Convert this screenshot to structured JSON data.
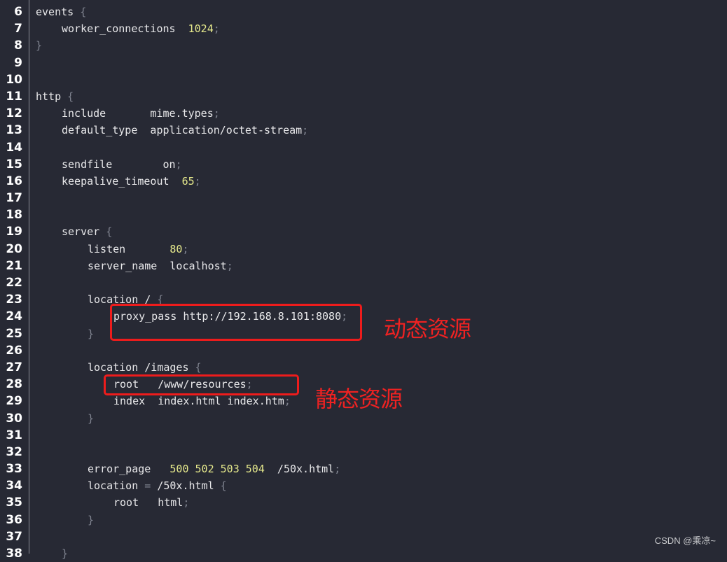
{
  "colors": {
    "background": "#272934",
    "line_number": "#ffffff",
    "code_text": "#e8e8ea",
    "number": "#e6e98c",
    "punctuation": "#7f838f",
    "annotation": "#ee1c1c"
  },
  "lines": [
    {
      "n": "6",
      "indent": 0,
      "tokens": [
        {
          "t": "events ",
          "k": "text"
        },
        {
          "t": "{",
          "k": "punct"
        }
      ]
    },
    {
      "n": "7",
      "indent": 1,
      "tokens": [
        {
          "t": "worker_connections  ",
          "k": "text"
        },
        {
          "t": "1024",
          "k": "num"
        },
        {
          "t": ";",
          "k": "punct"
        }
      ]
    },
    {
      "n": "8",
      "indent": 0,
      "tokens": [
        {
          "t": "}",
          "k": "punct"
        }
      ]
    },
    {
      "n": "9",
      "indent": 0,
      "tokens": []
    },
    {
      "n": "10",
      "indent": 0,
      "tokens": []
    },
    {
      "n": "11",
      "indent": 0,
      "tokens": [
        {
          "t": "http ",
          "k": "text"
        },
        {
          "t": "{",
          "k": "punct"
        }
      ]
    },
    {
      "n": "12",
      "indent": 1,
      "tokens": [
        {
          "t": "include       mime.types",
          "k": "text"
        },
        {
          "t": ";",
          "k": "punct"
        }
      ]
    },
    {
      "n": "13",
      "indent": 1,
      "tokens": [
        {
          "t": "default_type  application/octet-stream",
          "k": "text"
        },
        {
          "t": ";",
          "k": "punct"
        }
      ]
    },
    {
      "n": "14",
      "indent": 0,
      "tokens": []
    },
    {
      "n": "15",
      "indent": 1,
      "tokens": [
        {
          "t": "sendfile        on",
          "k": "text"
        },
        {
          "t": ";",
          "k": "punct"
        }
      ]
    },
    {
      "n": "16",
      "indent": 1,
      "tokens": [
        {
          "t": "keepalive_timeout  ",
          "k": "text"
        },
        {
          "t": "65",
          "k": "num"
        },
        {
          "t": ";",
          "k": "punct"
        }
      ]
    },
    {
      "n": "17",
      "indent": 0,
      "tokens": []
    },
    {
      "n": "18",
      "indent": 0,
      "tokens": []
    },
    {
      "n": "19",
      "indent": 1,
      "tokens": [
        {
          "t": "server ",
          "k": "text"
        },
        {
          "t": "{",
          "k": "punct"
        }
      ]
    },
    {
      "n": "20",
      "indent": 2,
      "tokens": [
        {
          "t": "listen       ",
          "k": "text"
        },
        {
          "t": "80",
          "k": "num"
        },
        {
          "t": ";",
          "k": "punct"
        }
      ]
    },
    {
      "n": "21",
      "indent": 2,
      "tokens": [
        {
          "t": "server_name  localhost",
          "k": "text"
        },
        {
          "t": ";",
          "k": "punct"
        }
      ]
    },
    {
      "n": "22",
      "indent": 0,
      "tokens": []
    },
    {
      "n": "23",
      "indent": 2,
      "tokens": [
        {
          "t": "location / ",
          "k": "text"
        },
        {
          "t": "{",
          "k": "punct"
        }
      ]
    },
    {
      "n": "24",
      "indent": 3,
      "tokens": [
        {
          "t": "proxy_pass http://192.168.8.101:8080",
          "k": "text"
        },
        {
          "t": ";",
          "k": "punct"
        }
      ]
    },
    {
      "n": "25",
      "indent": 2,
      "tokens": [
        {
          "t": "}",
          "k": "punct"
        }
      ]
    },
    {
      "n": "26",
      "indent": 0,
      "tokens": []
    },
    {
      "n": "27",
      "indent": 2,
      "tokens": [
        {
          "t": "location /images ",
          "k": "text"
        },
        {
          "t": "{",
          "k": "punct"
        }
      ]
    },
    {
      "n": "28",
      "indent": 3,
      "tokens": [
        {
          "t": "root   /www/resources",
          "k": "text"
        },
        {
          "t": ";",
          "k": "punct"
        }
      ]
    },
    {
      "n": "29",
      "indent": 3,
      "tokens": [
        {
          "t": "index  index.html index.htm",
          "k": "text"
        },
        {
          "t": ";",
          "k": "punct"
        }
      ]
    },
    {
      "n": "30",
      "indent": 2,
      "tokens": [
        {
          "t": "}",
          "k": "punct"
        }
      ]
    },
    {
      "n": "31",
      "indent": 0,
      "tokens": []
    },
    {
      "n": "32",
      "indent": 0,
      "tokens": []
    },
    {
      "n": "33",
      "indent": 2,
      "tokens": [
        {
          "t": "error_page   ",
          "k": "text"
        },
        {
          "t": "500 502 503 504",
          "k": "num"
        },
        {
          "t": "  /50x.html",
          "k": "text"
        },
        {
          "t": ";",
          "k": "punct"
        }
      ]
    },
    {
      "n": "34",
      "indent": 2,
      "tokens": [
        {
          "t": "location ",
          "k": "text"
        },
        {
          "t": "=",
          "k": "punct"
        },
        {
          "t": " /50x.html ",
          "k": "text"
        },
        {
          "t": "{",
          "k": "punct"
        }
      ]
    },
    {
      "n": "35",
      "indent": 3,
      "tokens": [
        {
          "t": "root   html",
          "k": "text"
        },
        {
          "t": ";",
          "k": "punct"
        }
      ]
    },
    {
      "n": "36",
      "indent": 2,
      "tokens": [
        {
          "t": "}",
          "k": "punct"
        }
      ]
    },
    {
      "n": "37",
      "indent": 0,
      "tokens": []
    },
    {
      "n": "38",
      "indent": 1,
      "tokens": [
        {
          "t": "}",
          "k": "punct"
        }
      ]
    }
  ],
  "annotations": {
    "dynamic": "动态资源",
    "static": "静态资源"
  },
  "watermark": "CSDN @乘凉~"
}
